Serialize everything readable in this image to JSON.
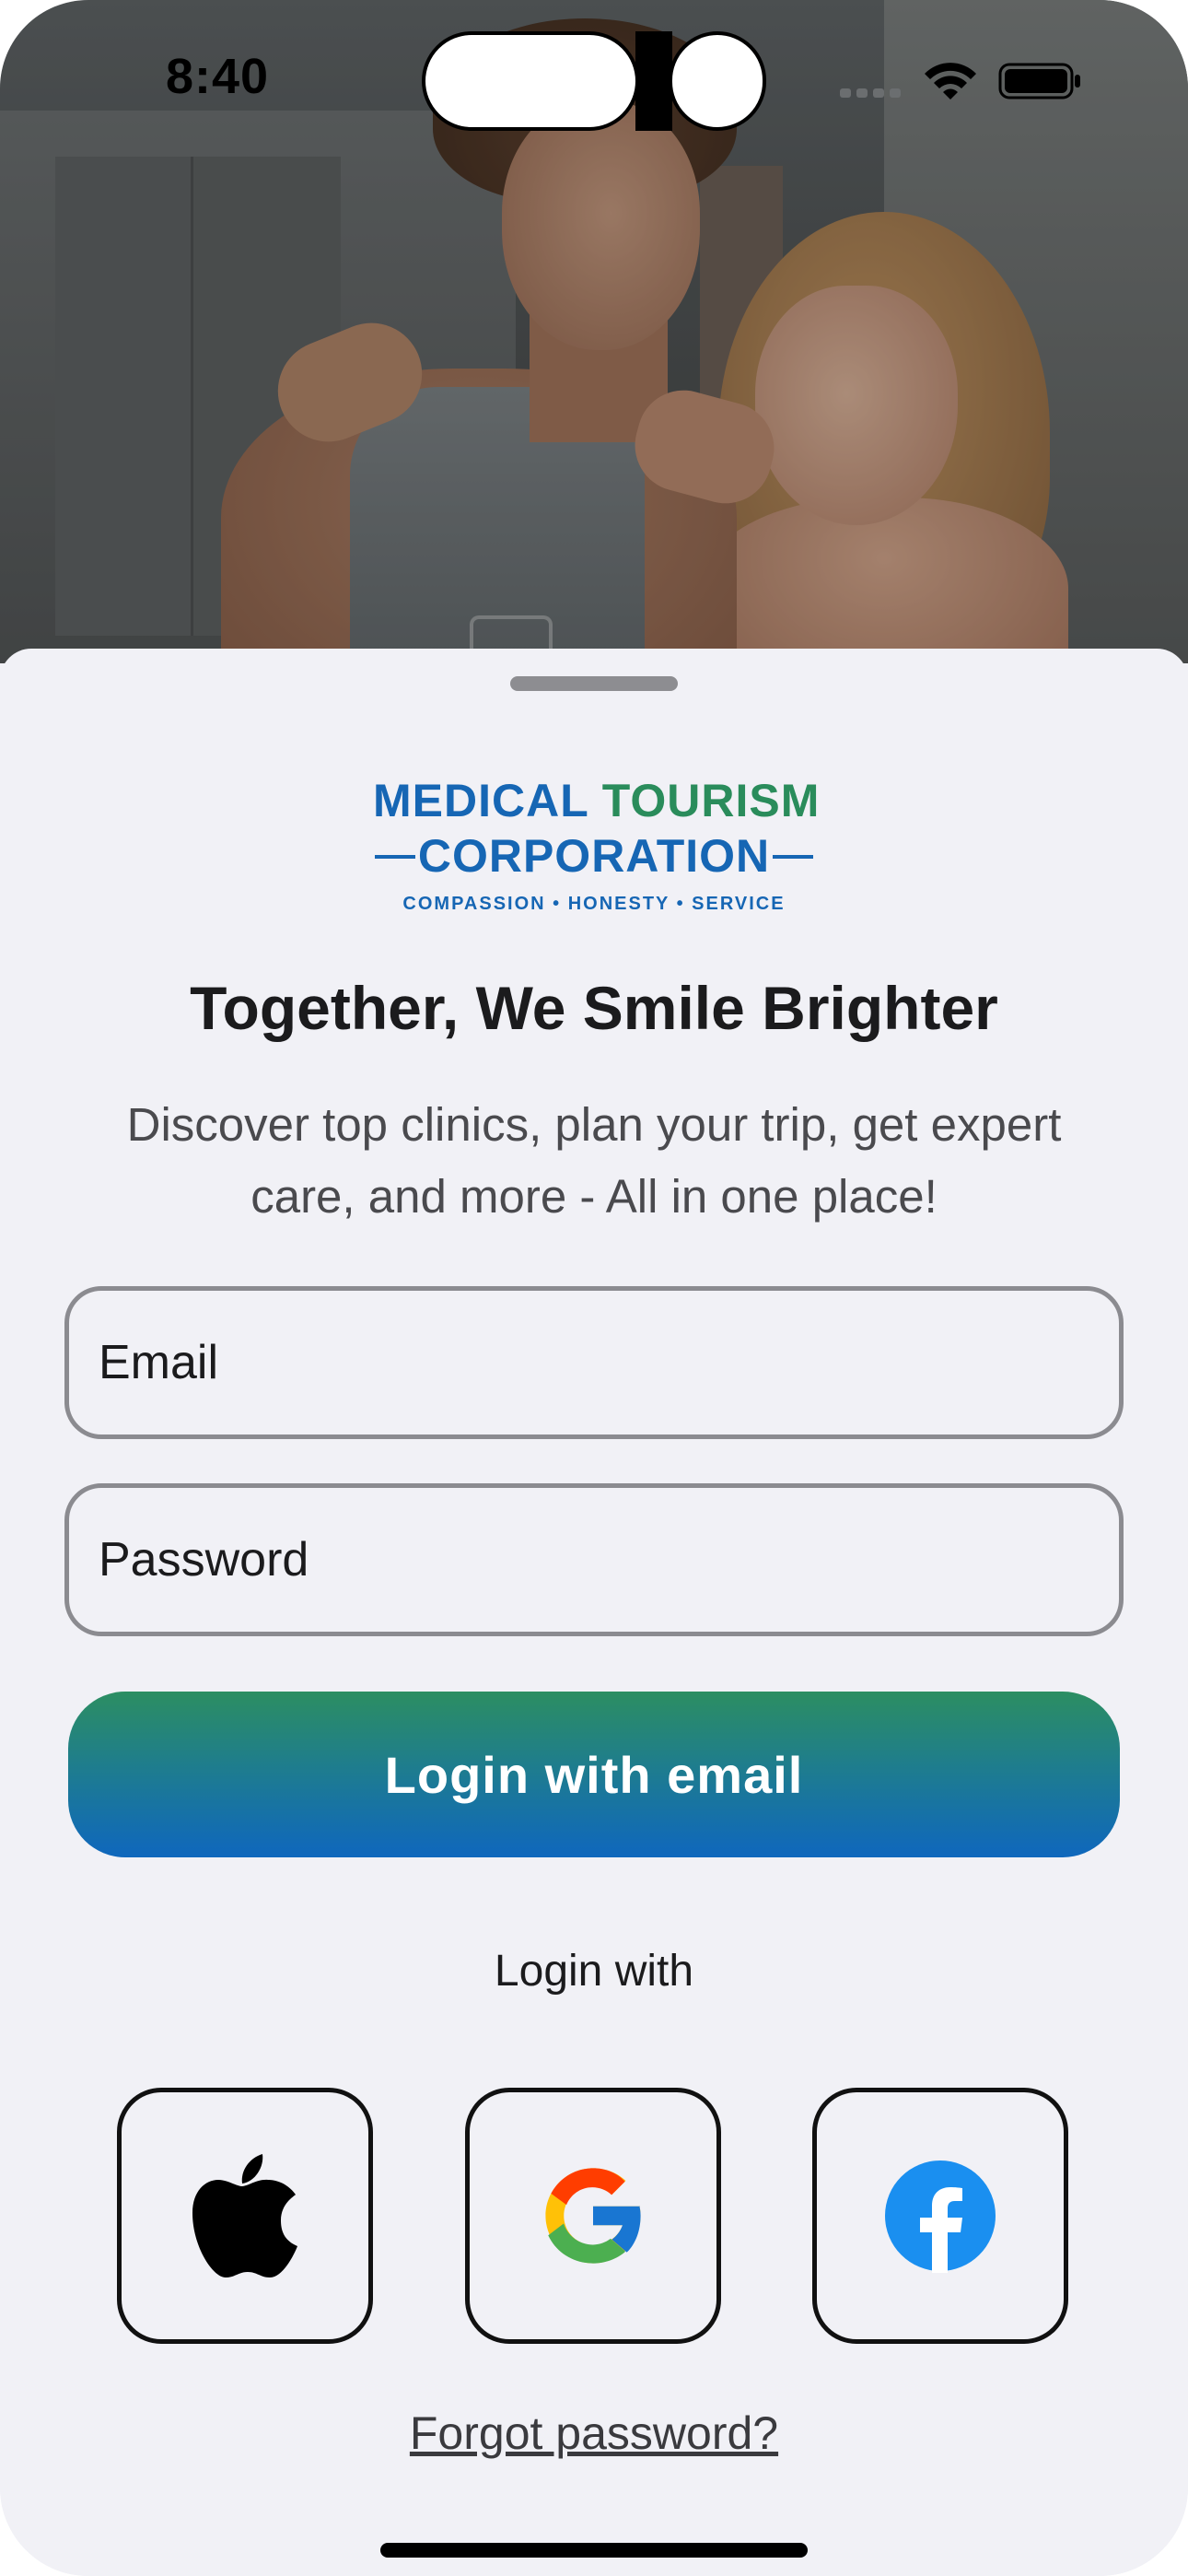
{
  "status_bar": {
    "time": "8:40",
    "icons": [
      "signal-icon",
      "wifi-icon",
      "battery-icon"
    ]
  },
  "hero": {
    "image": "couple-smiling-photo"
  },
  "logo": {
    "line1_part1": "MEDICAL",
    "line1_part2": "TOURISM",
    "line2": "CORPORATION",
    "tagline": "COMPASSION  •  HONESTY  •  SERVICE",
    "colors": {
      "blue": "#1666b4",
      "green": "#2a8c5b"
    }
  },
  "content": {
    "title": "Together, We Smile Brighter",
    "subtitle": "Discover top clinics, plan your trip, get expert care, and more - All in one place!"
  },
  "form": {
    "email_placeholder": "Email",
    "password_placeholder": "Password",
    "login_button": "Login with email",
    "button_gradient": [
      "#2c8e62",
      "#0f67bd"
    ]
  },
  "social": {
    "label": "Login with",
    "providers": [
      {
        "name": "Apple",
        "icon": "apple-icon"
      },
      {
        "name": "Google",
        "icon": "google-icon"
      },
      {
        "name": "Facebook",
        "icon": "facebook-icon"
      }
    ]
  },
  "footer": {
    "forgot_password": "Forgot password?"
  }
}
